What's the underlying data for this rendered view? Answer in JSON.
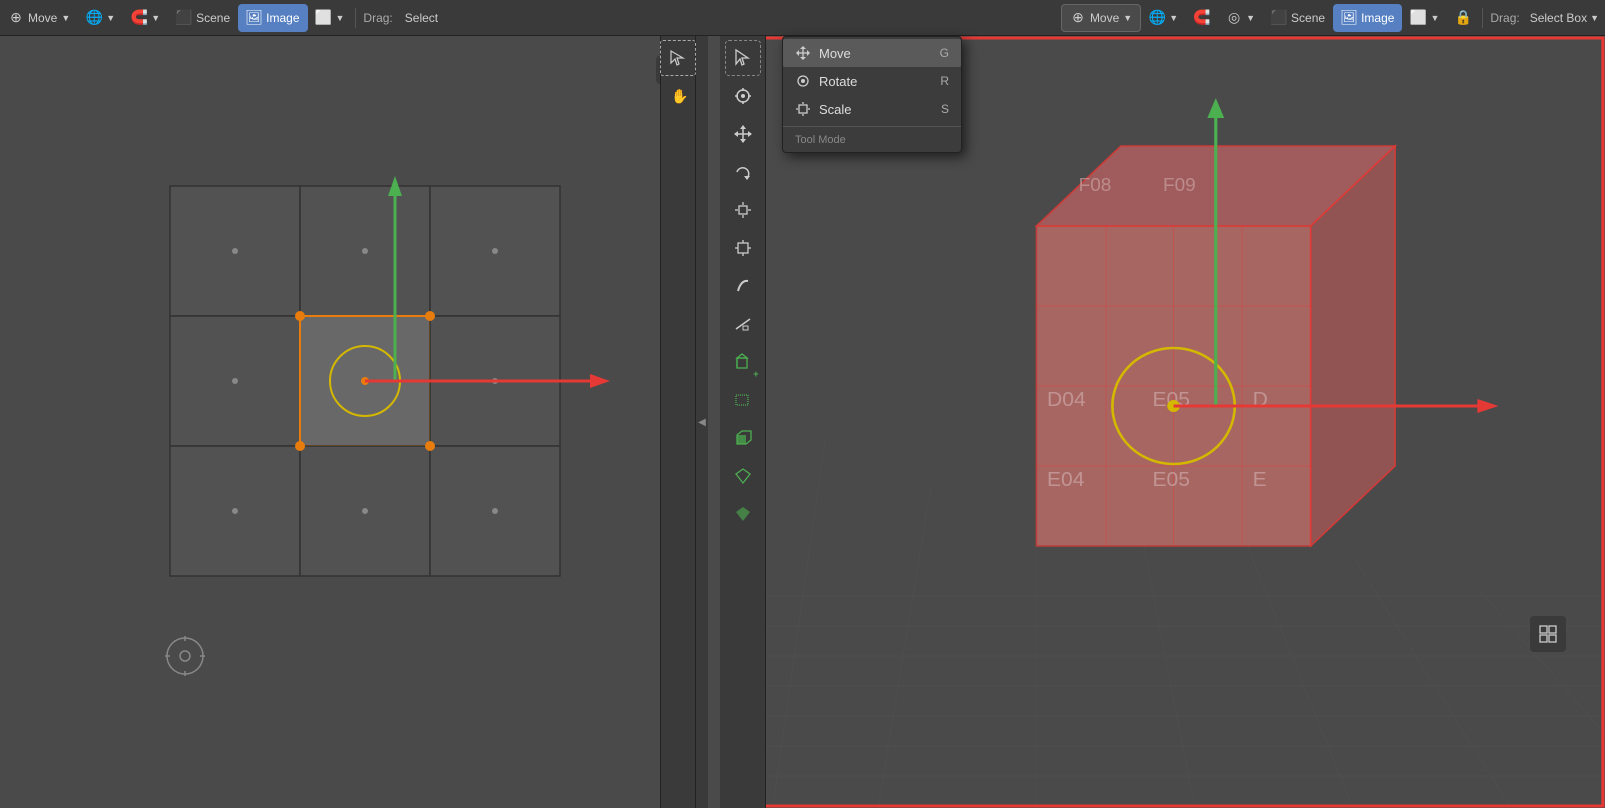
{
  "toolbar": {
    "left": {
      "move_label": "Move",
      "drag_label": "Drag:",
      "select_label": "Select",
      "scene_label": "Scene",
      "image_label": "Image"
    },
    "right": {
      "move_label": "Move",
      "drag_label": "Drag:",
      "select_box_label": "Select Box",
      "scene_label": "Scene",
      "image_label": "Image"
    }
  },
  "dropdown": {
    "items": [
      {
        "label": "Move",
        "shortcut": "G",
        "icon": "⊕",
        "highlighted": true
      },
      {
        "label": "Rotate",
        "shortcut": "R",
        "icon": "⟳"
      },
      {
        "label": "Scale",
        "shortcut": "S",
        "icon": "⤡"
      }
    ],
    "section_label": "Tool Mode"
  },
  "side_toolbar": {
    "buttons": [
      {
        "icon": "◻",
        "name": "select-box-tool"
      },
      {
        "icon": "✋",
        "name": "grab-tool"
      },
      {
        "icon": "⊕",
        "name": "cursor-tool"
      },
      {
        "icon": "✦",
        "name": "move-tool"
      },
      {
        "icon": "↺",
        "name": "rotate-tool"
      },
      {
        "icon": "⊡",
        "name": "scale-tool"
      },
      {
        "icon": "⊞",
        "name": "transform-tool"
      },
      {
        "icon": "✎",
        "name": "annotate-tool"
      },
      {
        "icon": "📐",
        "name": "measure-tool"
      },
      {
        "icon": "⊕",
        "name": "add-tool"
      },
      {
        "icon": "⊟",
        "name": "subtract-tool"
      },
      {
        "icon": "◈",
        "name": "shape-tool"
      }
    ]
  },
  "uv_grid": {
    "cells": 9,
    "selected_cell": 4
  },
  "colors": {
    "accent_blue": "#5680c2",
    "accent_orange": "#e87d0d",
    "bg_dark": "#3a3a3a",
    "bg_mid": "#4a4a4a",
    "bg_panel": "#3c3c3c",
    "green_arrow": "#4caf50",
    "red_arrow": "#e53935",
    "cube_pink": "#c8706a",
    "highlight_orange": "#e87d0d"
  }
}
